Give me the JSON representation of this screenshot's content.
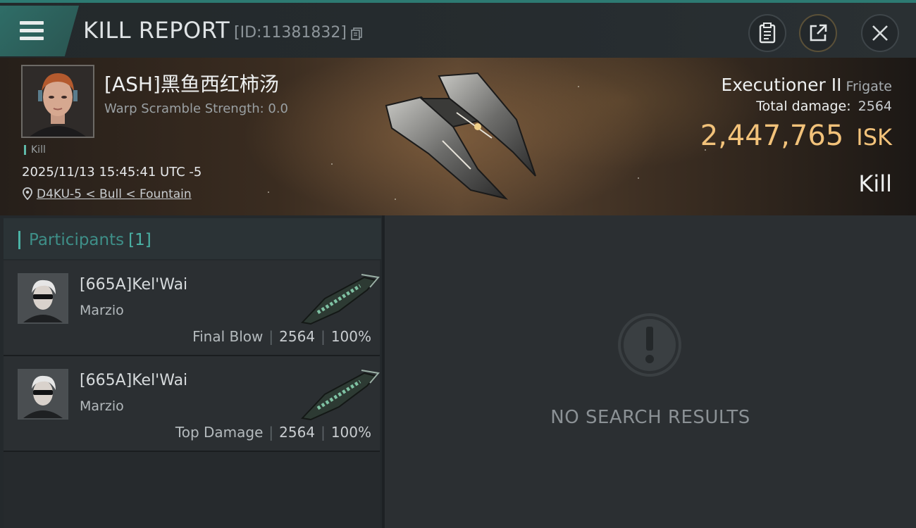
{
  "header": {
    "title": "KILL REPORT",
    "report_id": "[ID:11381832]",
    "icons": [
      "menu-icon",
      "copy-icon",
      "clipboard-icon",
      "share-icon",
      "close-icon"
    ]
  },
  "victim": {
    "name": "[ASH]黑鱼西红柿汤",
    "warp_scramble": "Warp Scramble Strength: 0.0",
    "tag": "Kill",
    "datetime": "2025/11/13 15:45:41 UTC -5",
    "location": "D4KU-5 < Bull < Fountain",
    "ship_name": "Executioner II",
    "ship_class": "Frigate",
    "total_damage_label": "Total damage:",
    "total_damage": "2564",
    "isk_value": "2,447,765",
    "isk_unit": "ISK",
    "result": "Kill"
  },
  "participants": {
    "title": "Participants",
    "count": "[1]",
    "items": [
      {
        "name": "[665A]Kel'Wai",
        "corp": "Marzio",
        "label": "Final Blow",
        "damage": "2564",
        "percent": "100%"
      },
      {
        "name": "[665A]Kel'Wai",
        "corp": "Marzio",
        "label": "Top Damage",
        "damage": "2564",
        "percent": "100%"
      }
    ]
  },
  "results": {
    "empty_text": "NO SEARCH RESULTS",
    "icon": "alert-icon"
  },
  "colors": {
    "accent": "#4bb3a6",
    "isk": "#f2c27a",
    "topbar_accent": "#2d7a72"
  }
}
